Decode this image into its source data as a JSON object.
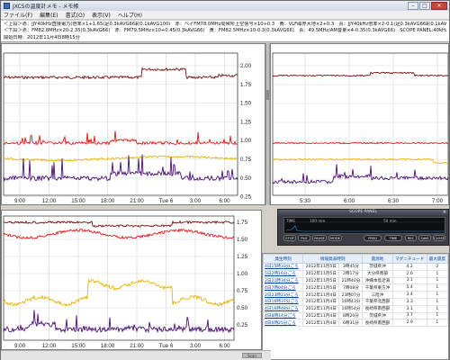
{
  "window": {
    "title": "JXCSの温度計メモ - メモ帳",
    "minimize": "–",
    "maximize": "□",
    "close": "✕"
  },
  "menu": [
    "ファイル(F)",
    "編集(E)",
    "書式(O)",
    "表示(V)",
    "ヘルプ(H)"
  ],
  "memo": [
    "＜上段＞赤：JJY40kHz直接電力(倍率×1+1.65(足0.3kAVG66彩0.1kAVG100)　赤：ベイFM78.0MHz局候所上空信号×10+0.3　黄：VLF磁界大地×2+0.3　青：JJY40kHz倍率×2-0.1(足0.3kAVG66彩0.1kAVG100)",
    "＜下段＞赤：FM82.8MHz×20-2.35(0.3kAVG66)　赤：FM79.5MHz×10+0.45(0.3kAVG66)　黄：FM82.5MHz×10-0.3(0.3kAVG66)　青：49.5MHz/AM音量×4-0.35(0.3kAVG66)　SCOPE PANEL:40kHz電界強度",
    "開始日時：2012年11月4日8時15分"
  ],
  "chart_top_left": {
    "y_ticks": [
      "2.00",
      "1.75",
      "1.50",
      "1.25",
      "1.00",
      "0.75",
      "0.50",
      "0.25"
    ],
    "x_ticks": [
      "9:00",
      "12:00",
      "15:00",
      "18:00",
      "21:00",
      "Tue 6",
      "3:00",
      "6:00"
    ],
    "colors": {
      "darkred": "#7a1010",
      "red": "#e01818",
      "yellow": "#e7b600",
      "purple": "#4c1075"
    }
  },
  "chart_top_right": {
    "x_ticks": [
      "5:30",
      "6:00",
      "6:30",
      "7:00"
    ],
    "colors": {
      "darkred": "#7a1010",
      "red": "#e01818",
      "yellow": "#e7b600",
      "purple": "#4c1075"
    }
  },
  "chart_bottom_left": {
    "y_ticks": [
      "1.75",
      "1.50",
      "1.25",
      "1.00",
      "0.75",
      "0.50",
      "0.25"
    ],
    "x_ticks": [
      "9:00",
      "12:00",
      "15:00",
      "18:00",
      "21:00",
      "Tue 6",
      "3:00",
      "6:00"
    ],
    "colors": {
      "darkred": "#7a1010",
      "red": "#e01818",
      "yellow": "#e7b600",
      "purple": "#4c1075"
    }
  },
  "scope": {
    "title": "SCOPE PANEL",
    "chan": "TIME",
    "time_left": "100 min",
    "time_right": "50 min",
    "buttons": [
      "STOP",
      "FILE",
      "PAUSE",
      "MODE",
      "FREQ",
      "TIME",
      "REC",
      "SAVE",
      "CLOSE"
    ]
  },
  "quake_table": {
    "headers": [
      "発生時刻",
      "情報発表時刻",
      "震源地",
      "マグニチュード",
      "最大震度"
    ],
    "rows": [
      [
        "4日15時33分ごろ",
        "2012年11月5日",
        "3時45分",
        "茨城県沖",
        "4.2",
        "2"
      ],
      [
        "5日2時16分ごろ",
        "2012年11月5日",
        "2時17分",
        "大分県南部",
        "2.6",
        "1"
      ],
      [
        "2日21時34分ごろ",
        "2012年11月5日",
        "21時40分",
        "沖縄本島近海",
        "3.1",
        "1"
      ],
      [
        "4日7時04分ごろ",
        "2012年11月5日",
        "7時08分",
        "千葉県東方沖",
        "5.4",
        "1"
      ],
      [
        "2日23時23分ごろ",
        "2012年11月4日",
        "23時07分",
        "三陸沖",
        "3.4",
        "1"
      ],
      [
        "4日16時37分ごろ",
        "2012年11月4日",
        "16時43分",
        "千葉県北西部",
        "3.3",
        "1"
      ],
      [
        "4日16時48分ごろ",
        "2012年11月4日",
        "16時54分",
        "長崎県南西部",
        "3.1",
        "1"
      ],
      [
        "4日8時14分ごろ",
        "2012年11月4日",
        "8時20分",
        "茨城県沖",
        "3.7",
        "1"
      ],
      [
        "4日6時25分ごろ",
        "2012年11月4日",
        "6時31分",
        "長崎県南西部",
        "2.9",
        "1"
      ]
    ]
  },
  "statusbar": {
    "scroll_label": "Scan"
  }
}
